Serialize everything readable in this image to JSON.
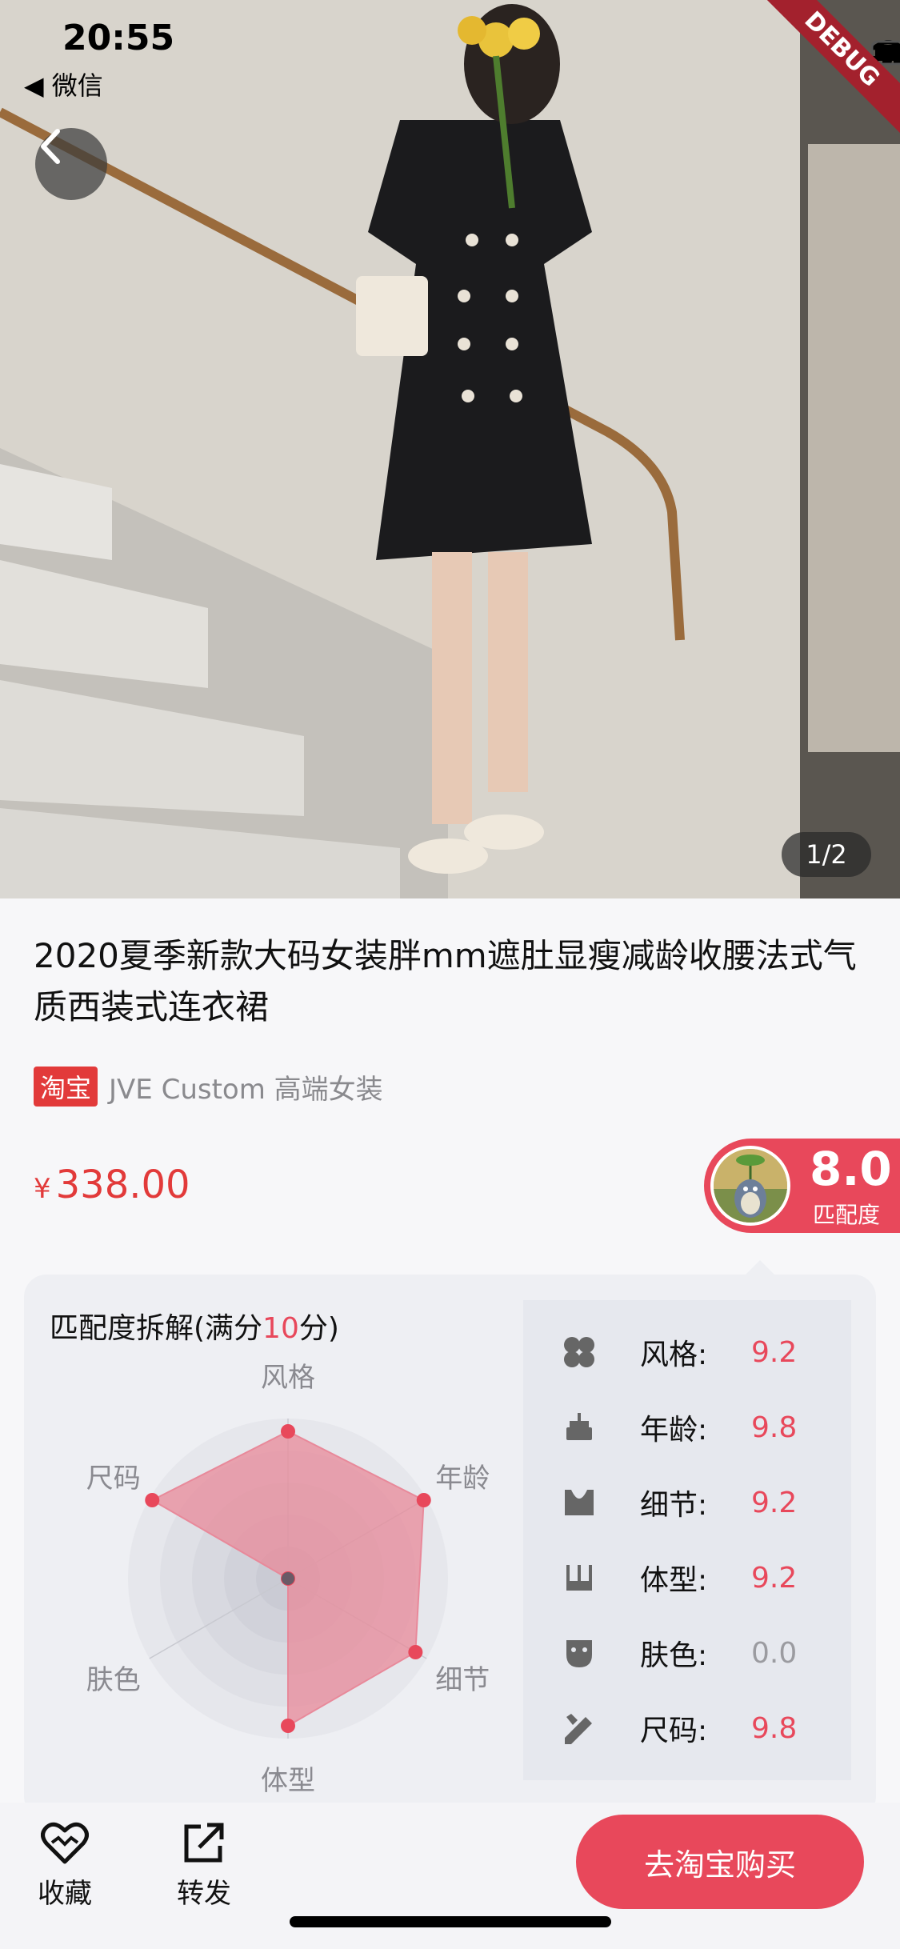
{
  "status_bar": {
    "time": "20:55",
    "back_app": "◀ 微信"
  },
  "debug_banner": "DEBUG",
  "gallery": {
    "indicator": "1/2"
  },
  "product": {
    "title": "2020夏季新款大码女装胖mm遮肚显瘦减龄收腰法式气质西装式连衣裙",
    "platform_tag": "淘宝",
    "shop_name": "JVE Custom 高端女装",
    "currency": "¥",
    "price": "338.00"
  },
  "match": {
    "score": "8.0",
    "label": "匹配度"
  },
  "breakdown": {
    "title_prefix": "匹配度拆解(满分",
    "title_highlight": "10",
    "title_suffix": "分)"
  },
  "chart_data": {
    "type": "radar",
    "title": "",
    "max": 10,
    "axes": [
      "风格",
      "年龄",
      "细节",
      "体型",
      "肤色",
      "尺码"
    ],
    "values": [
      9.2,
      9.8,
      9.2,
      9.2,
      0.0,
      9.8
    ]
  },
  "scores": [
    {
      "label": "风格:",
      "value": "9.2",
      "icon": "style-icon"
    },
    {
      "label": "年龄:",
      "value": "9.8",
      "icon": "age-cake-icon"
    },
    {
      "label": "细节:",
      "value": "9.2",
      "icon": "detail-bodice-icon"
    },
    {
      "label": "体型:",
      "value": "9.2",
      "icon": "body-shape-icon"
    },
    {
      "label": "肤色:",
      "value": "0.0",
      "icon": "skin-face-icon"
    },
    {
      "label": "尺码:",
      "value": "9.8",
      "icon": "size-ruler-pencil-icon"
    }
  ],
  "bottom_bar": {
    "favorite": "收藏",
    "share": "转发",
    "buy": "去淘宝购买"
  },
  "colors": {
    "accent": "#e8485b",
    "price": "#e23a3a",
    "radar_fill": "#e8899a"
  }
}
